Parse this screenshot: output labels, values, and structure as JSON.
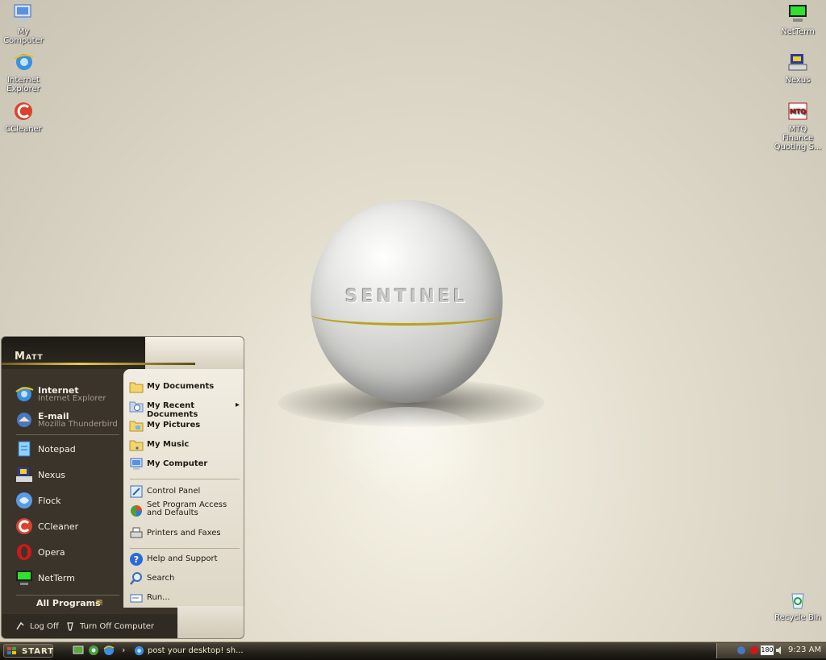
{
  "desktop": {
    "icons_left": [
      {
        "label": "My Computer",
        "icon": "my-computer-icon"
      },
      {
        "label": "Internet Explorer",
        "icon": "internet-explorer-icon"
      },
      {
        "label": "CCleaner",
        "icon": "ccleaner-icon"
      }
    ],
    "icons_right": [
      {
        "label": "NetTerm",
        "icon": "netterm-icon"
      },
      {
        "label": "Nexus",
        "icon": "nexus-icon"
      },
      {
        "label": "MTQ Finance Quoting S...",
        "icon": "mtq-icon"
      }
    ],
    "recycle_bin": {
      "label": "Recycle Bin",
      "icon": "recycle-bin-icon"
    },
    "wallpaper_text": "SENTINEL",
    "mtq_badge": "MTQ"
  },
  "start_menu": {
    "user": "Matt",
    "pinned": [
      {
        "title": "Internet",
        "subtitle": "Internet Explorer",
        "icon": "internet-explorer-icon"
      },
      {
        "title": "E-mail",
        "subtitle": "Mozilla Thunderbird",
        "icon": "thunderbird-icon"
      }
    ],
    "recent": [
      {
        "label": "Notepad",
        "icon": "notepad-icon"
      },
      {
        "label": "Nexus",
        "icon": "nexus-icon"
      },
      {
        "label": "Flock",
        "icon": "flock-icon"
      },
      {
        "label": "CCleaner",
        "icon": "ccleaner-icon"
      },
      {
        "label": "Opera",
        "icon": "opera-icon"
      },
      {
        "label": "NetTerm",
        "icon": "netterm-icon"
      }
    ],
    "all_programs": "All Programs",
    "all_programs_arrow": "≡",
    "right": {
      "group1": [
        {
          "label": "My Documents",
          "icon": "folder-documents-icon"
        },
        {
          "label": "My Recent Documents",
          "icon": "recent-documents-icon",
          "arrow": "▸"
        },
        {
          "label": "My Pictures",
          "icon": "folder-pictures-icon"
        },
        {
          "label": "My Music",
          "icon": "folder-music-icon"
        },
        {
          "label": "My Computer",
          "icon": "my-computer-icon"
        }
      ],
      "group2": [
        {
          "label": "Control Panel",
          "icon": "control-panel-icon"
        },
        {
          "label": "Set Program Access and Defaults",
          "icon": "program-access-icon"
        },
        {
          "label": "Printers and Faxes",
          "icon": "printer-icon"
        }
      ],
      "group3": [
        {
          "label": "Help and Support",
          "icon": "help-icon"
        },
        {
          "label": "Search",
          "icon": "search-icon"
        },
        {
          "label": "Run...",
          "icon": "run-icon"
        }
      ]
    },
    "footer": {
      "log_off": "Log Off",
      "turn_off": "Turn Off Computer"
    }
  },
  "taskbar": {
    "start_label": "START",
    "quick_launch": [
      "show-desktop-icon",
      "media-icon",
      "explorer-icon"
    ],
    "chevron": "›",
    "task": {
      "label": "post your desktop! sh...",
      "icon": "internet-explorer-icon"
    },
    "tray": {
      "clock": "9:23 AM",
      "badge": "180"
    }
  },
  "colors": {
    "accent": "#e7c94d",
    "menu_dark": "#3b342b",
    "menu_light": "#f1ede2"
  }
}
